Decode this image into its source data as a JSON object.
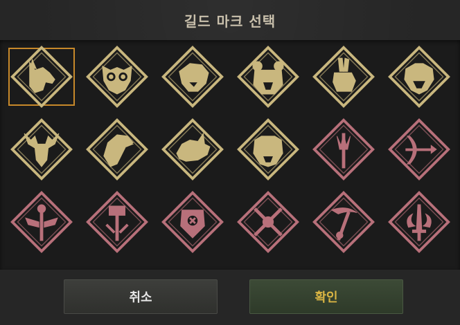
{
  "dialog": {
    "title": "길드 마크 선택",
    "cancel_label": "취소",
    "confirm_label": "확인"
  },
  "colors": {
    "gold": "#c9b77e",
    "rose": "#b8707a",
    "selected_border": "#c8892a"
  },
  "marks": [
    {
      "name": "wolf",
      "color": "gold",
      "selected": true
    },
    {
      "name": "owl",
      "color": "gold",
      "selected": false
    },
    {
      "name": "panther",
      "color": "gold",
      "selected": false
    },
    {
      "name": "bear",
      "color": "gold",
      "selected": false
    },
    {
      "name": "rabbit",
      "color": "gold",
      "selected": false
    },
    {
      "name": "snake",
      "color": "gold",
      "selected": false
    },
    {
      "name": "deer",
      "color": "gold",
      "selected": false
    },
    {
      "name": "eagle",
      "color": "gold",
      "selected": false
    },
    {
      "name": "rhino",
      "color": "gold",
      "selected": false
    },
    {
      "name": "tiger",
      "color": "gold",
      "selected": false
    },
    {
      "name": "trident",
      "color": "rose",
      "selected": false
    },
    {
      "name": "bow",
      "color": "rose",
      "selected": false
    },
    {
      "name": "winged-staff",
      "color": "rose",
      "selected": false
    },
    {
      "name": "hammer",
      "color": "rose",
      "selected": false
    },
    {
      "name": "shield",
      "color": "rose",
      "selected": false
    },
    {
      "name": "crossed-swords",
      "color": "rose",
      "selected": false
    },
    {
      "name": "scythe",
      "color": "rose",
      "selected": false
    },
    {
      "name": "flaming-sword",
      "color": "rose",
      "selected": false
    }
  ]
}
